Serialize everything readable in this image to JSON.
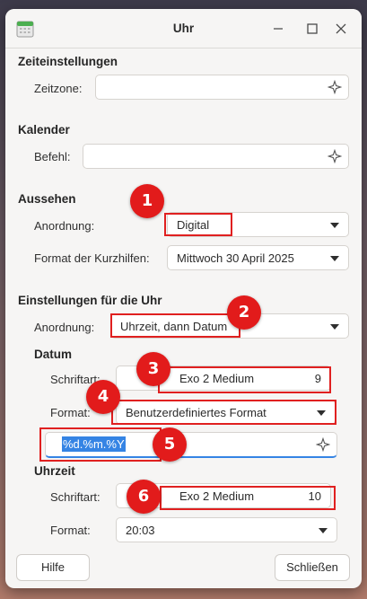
{
  "window": {
    "title": "Uhr"
  },
  "time_settings": {
    "heading": "Zeiteinstellungen",
    "timezone_label": "Zeitzone:",
    "timezone_value": ""
  },
  "calendar": {
    "heading": "Kalender",
    "command_label": "Befehl:",
    "command_value": ""
  },
  "appearance": {
    "heading": "Aussehen",
    "layout_label": "Anordnung:",
    "layout_value": "Digital",
    "tooltip_format_label": "Format der Kurzhilfen:",
    "tooltip_format_value": "Mittwoch 30 April 2025"
  },
  "clock_settings": {
    "heading": "Einstellungen für die Uhr",
    "layout_label": "Anordnung:",
    "layout_value": "Uhrzeit, dann Datum",
    "date": {
      "heading": "Datum",
      "font_label": "Schriftart:",
      "font_name": "Exo 2 Medium",
      "font_size": "9",
      "format_label": "Format:",
      "format_value": "Benutzerdefiniertes Format",
      "custom_format": "%d.%m.%Y"
    },
    "time": {
      "heading": "Uhrzeit",
      "font_label": "Schriftart:",
      "font_name": "Exo 2 Medium",
      "font_size": "10",
      "format_label": "Format:",
      "format_value": "20:03"
    }
  },
  "buttons": {
    "help": "Hilfe",
    "close": "Schließen"
  },
  "annotations": [
    "1",
    "2",
    "3",
    "4",
    "5",
    "6"
  ],
  "colors": {
    "annotation_red": "#e21b1b",
    "selection_blue": "#3584e4"
  }
}
